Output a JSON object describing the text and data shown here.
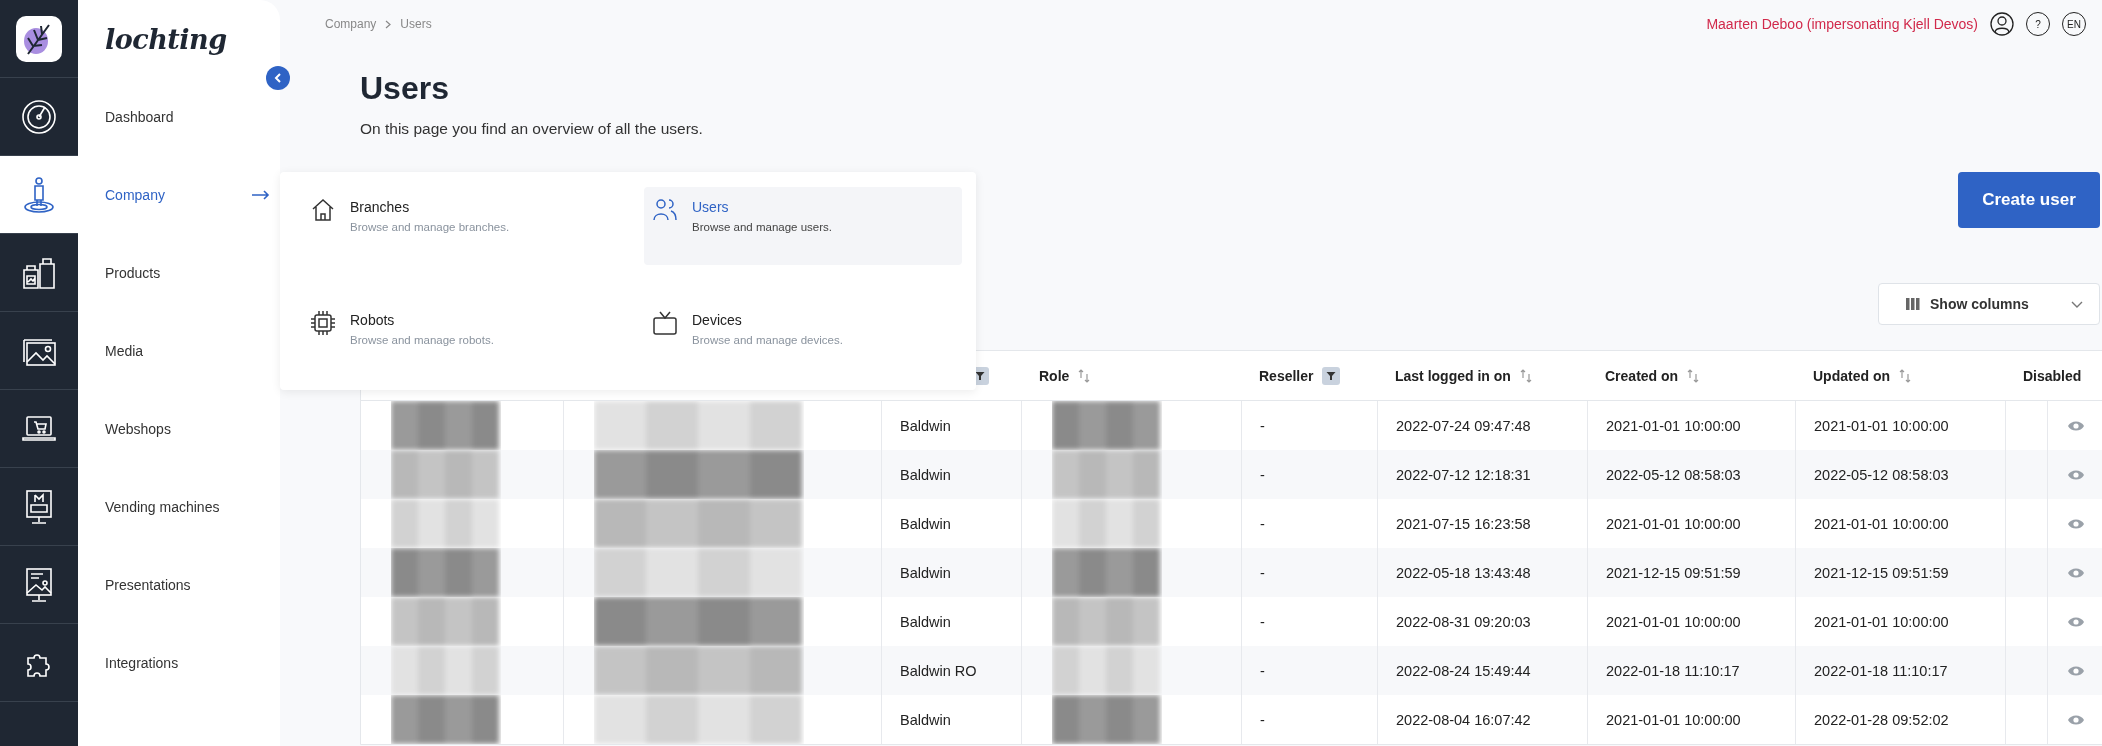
{
  "sidebar": {
    "logo": "lochting",
    "items": [
      {
        "label": "Dashboard",
        "selected": false
      },
      {
        "label": "Company",
        "selected": true
      },
      {
        "label": "Products",
        "selected": false
      },
      {
        "label": "Media",
        "selected": false
      },
      {
        "label": "Webshops",
        "selected": false
      },
      {
        "label": "Vending machines",
        "selected": false
      },
      {
        "label": "Presentations",
        "selected": false
      },
      {
        "label": "Integrations",
        "selected": false
      }
    ]
  },
  "breadcrumb": [
    "Company",
    "Users"
  ],
  "account": {
    "user": "Maarten Deboo (impersonating Kjell Devos)",
    "help": "?",
    "language": "EN"
  },
  "page": {
    "title": "Users",
    "subtitle": "On this page you find an overview of all the users."
  },
  "submenu": [
    {
      "title": "Branches",
      "description": "Browse and manage branches.",
      "selected": false
    },
    {
      "title": "Users",
      "description": "Browse and manage users.",
      "selected": true
    },
    {
      "title": "Robots",
      "description": "Browse and manage robots.",
      "selected": false
    },
    {
      "title": "Devices",
      "description": "Browse and manage devices.",
      "selected": false
    }
  ],
  "actions": {
    "create": "Create user",
    "show_columns": "Show columns"
  },
  "table": {
    "columns": [
      {
        "sortable": false,
        "filter": false
      },
      {
        "sortable": false,
        "filter": false
      },
      {
        "sortable": false,
        "filter": true
      },
      {
        "label": "Role",
        "sortable": true,
        "filter": false
      },
      {
        "label": "Reseller",
        "sortable": false,
        "filter": true
      },
      {
        "label": "Last logged in on",
        "sortable": true,
        "filter": false
      },
      {
        "label": "Created on",
        "sortable": true,
        "filter": false
      },
      {
        "label": "Updated on",
        "sortable": true,
        "filter": false
      },
      {
        "label": "Disabled",
        "sortable": false,
        "filter": false
      }
    ],
    "rows": [
      {
        "cells": [
          {
            "kind": "redacted"
          },
          {
            "kind": "redacted"
          },
          {
            "kind": "text",
            "text": "Baldwin"
          },
          {
            "kind": "redacted"
          },
          {
            "kind": "text",
            "text": "-"
          },
          {
            "kind": "text",
            "text": "2022-07-24 09:47:48"
          },
          {
            "kind": "text",
            "text": "2021-01-01 10:00:00"
          },
          {
            "kind": "text",
            "text": "2021-01-01 10:00:00"
          },
          {
            "kind": "view"
          }
        ]
      },
      {
        "cells": [
          {
            "kind": "redacted"
          },
          {
            "kind": "redacted"
          },
          {
            "kind": "text",
            "text": "Baldwin"
          },
          {
            "kind": "redacted"
          },
          {
            "kind": "text",
            "text": "-"
          },
          {
            "kind": "text",
            "text": "2022-07-12 12:18:31"
          },
          {
            "kind": "text",
            "text": "2022-05-12 08:58:03"
          },
          {
            "kind": "text",
            "text": "2022-05-12 08:58:03"
          },
          {
            "kind": "view"
          }
        ]
      },
      {
        "cells": [
          {
            "kind": "redacted"
          },
          {
            "kind": "redacted"
          },
          {
            "kind": "text",
            "text": "Baldwin"
          },
          {
            "kind": "redacted"
          },
          {
            "kind": "text",
            "text": "-"
          },
          {
            "kind": "text",
            "text": "2021-07-15 16:23:58"
          },
          {
            "kind": "text",
            "text": "2021-01-01 10:00:00"
          },
          {
            "kind": "text",
            "text": "2021-01-01 10:00:00"
          },
          {
            "kind": "view"
          }
        ]
      },
      {
        "cells": [
          {
            "kind": "redacted"
          },
          {
            "kind": "redacted"
          },
          {
            "kind": "text",
            "text": "Baldwin"
          },
          {
            "kind": "redacted"
          },
          {
            "kind": "text",
            "text": "-"
          },
          {
            "kind": "text",
            "text": "2022-05-18 13:43:48"
          },
          {
            "kind": "text",
            "text": "2021-12-15 09:51:59"
          },
          {
            "kind": "text",
            "text": "2021-12-15 09:51:59"
          },
          {
            "kind": "view"
          }
        ]
      },
      {
        "cells": [
          {
            "kind": "redacted"
          },
          {
            "kind": "redacted"
          },
          {
            "kind": "text",
            "text": "Baldwin"
          },
          {
            "kind": "redacted"
          },
          {
            "kind": "text",
            "text": "-"
          },
          {
            "kind": "text",
            "text": "2022-08-31 09:20:03"
          },
          {
            "kind": "text",
            "text": "2021-01-01 10:00:00"
          },
          {
            "kind": "text",
            "text": "2021-01-01 10:00:00"
          },
          {
            "kind": "view"
          }
        ]
      },
      {
        "cells": [
          {
            "kind": "redacted"
          },
          {
            "kind": "redacted"
          },
          {
            "kind": "text",
            "text": "Baldwin RO"
          },
          {
            "kind": "redacted"
          },
          {
            "kind": "text",
            "text": "-"
          },
          {
            "kind": "text",
            "text": "2022-08-24 15:49:44"
          },
          {
            "kind": "text",
            "text": "2022-01-18 11:10:17"
          },
          {
            "kind": "text",
            "text": "2022-01-18 11:10:17"
          },
          {
            "kind": "view"
          }
        ]
      },
      {
        "cells": [
          {
            "kind": "redacted"
          },
          {
            "kind": "redacted"
          },
          {
            "kind": "text",
            "text": "Baldwin"
          },
          {
            "kind": "redacted"
          },
          {
            "kind": "text",
            "text": "-"
          },
          {
            "kind": "text",
            "text": "2022-08-04 16:07:42"
          },
          {
            "kind": "text",
            "text": "2021-01-01 10:00:00"
          },
          {
            "kind": "text",
            "text": "2022-01-28 09:52:02"
          },
          {
            "kind": "view"
          }
        ]
      }
    ]
  }
}
